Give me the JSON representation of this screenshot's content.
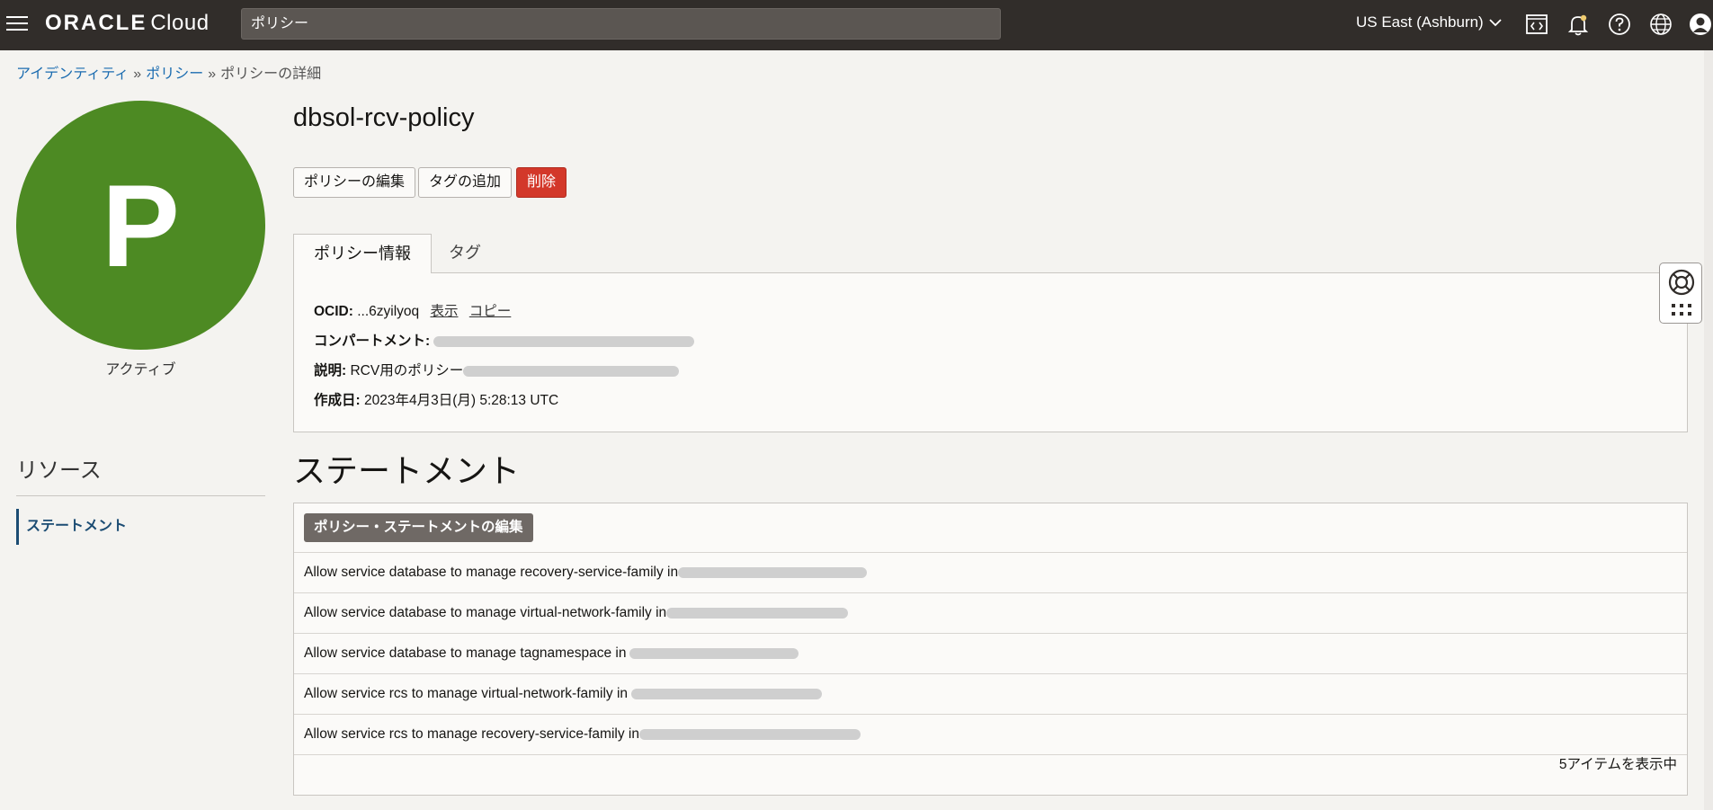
{
  "header": {
    "brand": "ORACLE",
    "product": "Cloud",
    "search_value": "ポリシー",
    "region": "US East (Ashburn)"
  },
  "breadcrumb": {
    "items": [
      "アイデンティティ",
      "ポリシー"
    ],
    "separator": "»",
    "current": "ポリシーの詳細"
  },
  "avatar": {
    "letter": "P",
    "color": "#4d8a23"
  },
  "status": "アクティブ",
  "resources": {
    "title": "リソース",
    "items": [
      "ステートメント"
    ]
  },
  "policy": {
    "name": "dbsol-rcv-policy",
    "actions": {
      "edit": "ポリシーの編集",
      "add_tags": "タグの追加",
      "delete": "削除"
    },
    "tabs": [
      "ポリシー情報",
      "タグ"
    ],
    "info": {
      "ocid_label": "OCID:",
      "ocid_value": "...6zyilyoq",
      "show_link": "表示",
      "copy_link": "コピー",
      "compartment_label": "コンパートメント:",
      "description_label": "説明:",
      "description_value": "RCV用のポリシー",
      "created_label": "作成日:",
      "created_value": "2023年4月3日(月) 5:28:13 UTC"
    }
  },
  "statements": {
    "title": "ステートメント",
    "edit_button": "ポリシー・ステートメントの編集",
    "rows": [
      "Allow service database to manage recovery-service-family in",
      "Allow service database to manage virtual-network-family in",
      "Allow service database to manage tagnamespace in",
      "Allow service rcs to manage virtual-network-family in",
      "Allow service rcs to manage recovery-service-family in"
    ],
    "footer": "5アイテムを表示中"
  }
}
